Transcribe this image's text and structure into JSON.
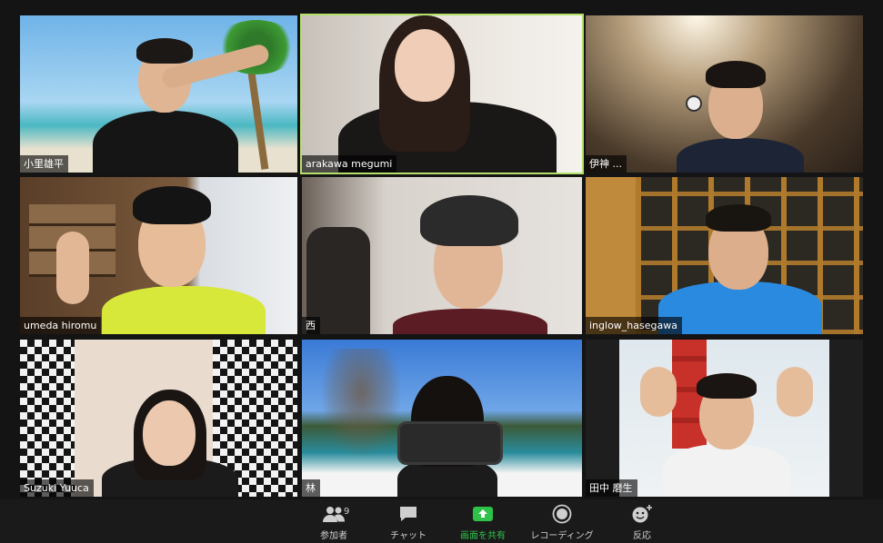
{
  "participants": [
    {
      "name": "小里雄平"
    },
    {
      "name": "arakawa megumi"
    },
    {
      "name": "伊神 ",
      "suffix": "..."
    },
    {
      "name": "umeda hiromu"
    },
    {
      "name": "西 "
    },
    {
      "name": "inglow_hasegawa"
    },
    {
      "name": "Suzuki Yuuca"
    },
    {
      "name": "林 "
    },
    {
      "name": "田中 磨生"
    }
  ],
  "toolbar": {
    "participants_label": "参加者",
    "participants_count": "9",
    "chat_label": "チャット",
    "share_label": "画面を共有",
    "record_label": "レコーディング",
    "reaction_label": "反応"
  },
  "colors": {
    "active_speaker": "#b5e06a",
    "share_green": "#2fc24a",
    "toolbar_bg": "#1a1a1a"
  }
}
